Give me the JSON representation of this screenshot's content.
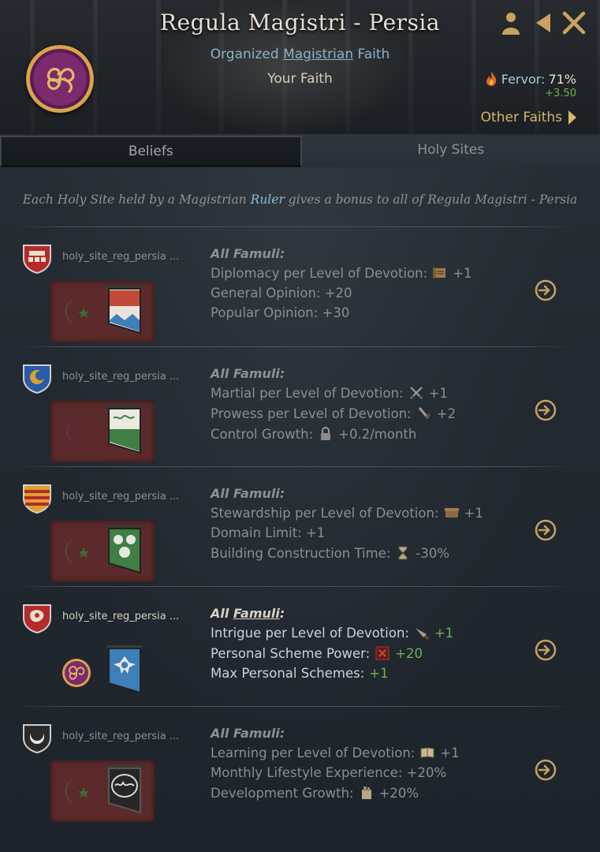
{
  "header": {
    "title": "Regula Magistri - Persia",
    "subtitle_prefix": "Organized ",
    "subtitle_link": "Magistrian",
    "subtitle_suffix": " Faith",
    "your_faith": "Your Faith",
    "fervor_label": "Fervor: ",
    "fervor_value": "71%",
    "fervor_delta": "+3.50",
    "other_faiths": "Other Faiths"
  },
  "tabs": [
    {
      "label": "Beliefs",
      "active": true
    },
    {
      "label": "Holy Sites",
      "active": false
    }
  ],
  "intro": {
    "prefix": "Each Holy Site held by a Magistrian ",
    "highlight": "Ruler",
    "suffix": " gives a bonus to all of Regula Magistri - Persia"
  },
  "sites": [
    {
      "name": "holy_site_reg_persia ...",
      "heading": "All Famuli:",
      "effects": [
        {
          "text": "Diplomacy per Level of Devotion:",
          "value": "+1",
          "icon": "scroll-icon"
        },
        {
          "text": "General Opinion: +20"
        },
        {
          "text": "Popular Opinion: +30"
        }
      ]
    },
    {
      "name": "holy_site_reg_persia ...",
      "heading": "All Famuli:",
      "effects": [
        {
          "text": "Martial per Level of Devotion:",
          "value": "+1",
          "icon": "crossed-swords-icon"
        },
        {
          "text": "Prowess per Level of Devotion:",
          "value": "+2",
          "icon": "sword-icon"
        },
        {
          "text": "Control Growth:",
          "value": "+0.2/month",
          "icon": "lock-icon"
        }
      ]
    },
    {
      "name": "holy_site_reg_persia ...",
      "heading": "All Famuli:",
      "effects": [
        {
          "text": "Stewardship per Level of Devotion:",
          "value": "+1",
          "icon": "treasury-icon"
        },
        {
          "text": "Domain Limit: +1"
        },
        {
          "text": "Building Construction Time:",
          "value": "-30%",
          "icon": "hourglass-icon"
        }
      ]
    },
    {
      "name": "holy_site_reg_persia ...",
      "heading_prefix": "All ",
      "heading_link": "Famuli",
      "heading_suffix": ":",
      "effects": [
        {
          "text": "Intrigue per Level of Devotion:",
          "value": "+1",
          "icon": "dagger-icon"
        },
        {
          "text": "Personal Scheme Power:",
          "value": "+20",
          "icon": "scheme-icon"
        },
        {
          "text": "Max Personal Schemes:",
          "value": "+1"
        }
      ]
    },
    {
      "name": "holy_site_reg_persia ...",
      "heading": "All Famuli:",
      "effects": [
        {
          "text": "Learning per Level of Devotion:",
          "value": "+1",
          "icon": "book-icon"
        },
        {
          "text": "Monthly Lifestyle Experience: +20%"
        },
        {
          "text": "Development Growth:",
          "value": "+20%",
          "icon": "development-icon"
        }
      ]
    }
  ],
  "colors": {
    "accent_gold": "#d7b56c",
    "link_blue": "#8fb8d0",
    "positive_green": "#6fb052"
  }
}
